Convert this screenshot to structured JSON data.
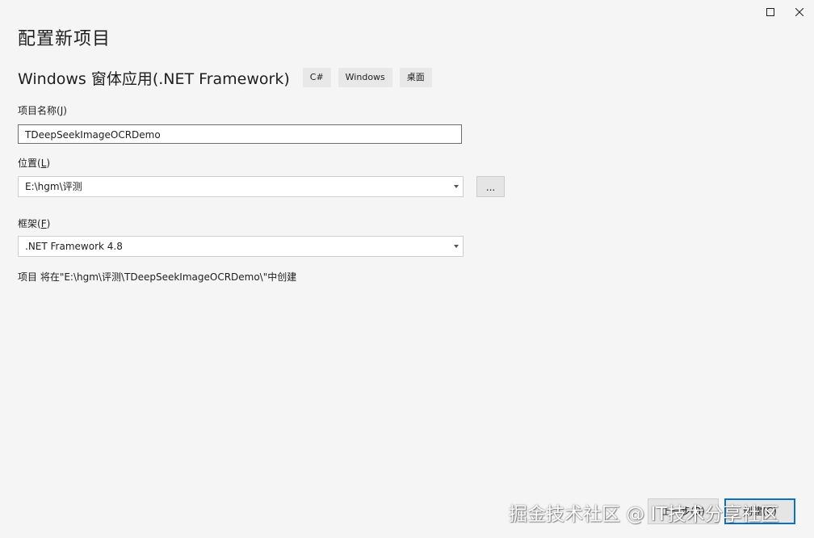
{
  "window": {
    "maximize_icon": "maximize-icon",
    "close_icon": "close-icon"
  },
  "page_title": "配置新项目",
  "template": {
    "name": "Windows 窗体应用(.NET Framework)",
    "tags": [
      "C#",
      "Windows",
      "桌面"
    ]
  },
  "project_name": {
    "label": "项目名称",
    "accel": "J",
    "value": "TDeepSeekImageOCRDemo"
  },
  "location": {
    "label": "位置",
    "accel": "L",
    "value": "E:\\hgm\\评测",
    "browse_label": "...",
    "arrow_icon": "chevron-down-icon"
  },
  "framework": {
    "label": "框架",
    "accel": "F",
    "value": ".NET Framework 4.8",
    "arrow_icon": "chevron-down-icon"
  },
  "summary": "项目 将在\"E:\\hgm\\评测\\TDeepSeekImageOCRDemo\\\"中创建",
  "footer": {
    "back_label": "上一步(B)",
    "create_label": "创建(C)"
  },
  "watermark": "掘金技术社区 @ IT技术分享社区",
  "colors": {
    "background": "#f5f5f5",
    "accent": "#0e70c0",
    "tag_background": "#e8e8e8"
  }
}
